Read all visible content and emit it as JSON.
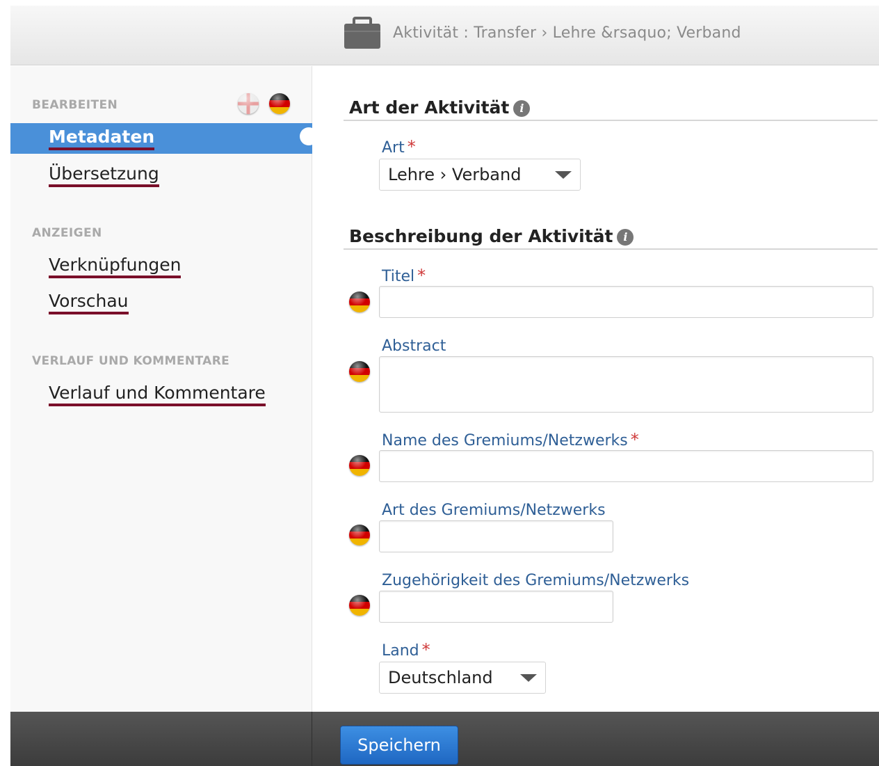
{
  "header": {
    "title": "Aktivität : Transfer › Lehre &rsaquo; Verband",
    "icon": "briefcase-icon"
  },
  "sidebar": {
    "edit_heading": "BEARBEITEN",
    "edit_items": [
      {
        "label": "Metadaten",
        "active": true
      },
      {
        "label": "Übersetzung",
        "active": false
      }
    ],
    "view_heading": "ANZEIGEN",
    "view_items": [
      {
        "label": "Verknüpfungen"
      },
      {
        "label": "Vorschau"
      }
    ],
    "history_heading": "VERLAUF UND KOMMENTARE",
    "history_items": [
      {
        "label": "Verlauf und Kommentare"
      }
    ],
    "language_flags": [
      "uk-flag-icon",
      "de-flag-icon"
    ]
  },
  "main": {
    "section_type": {
      "title": "Art der Aktivität",
      "field_art": {
        "label": "Art",
        "required": "*",
        "value": "Lehre › Verband"
      }
    },
    "section_description": {
      "title": "Beschreibung der Aktivität",
      "fields": [
        {
          "label": "Titel",
          "required": "*",
          "value": ""
        },
        {
          "label": "Abstract",
          "required": "",
          "value": ""
        },
        {
          "label": "Name des Gremiums/Netzwerks",
          "required": "*",
          "value": ""
        },
        {
          "label": "Art des Gremiums/Netzwerks",
          "required": "",
          "value": ""
        },
        {
          "label": "Zugehörigkeit des Gremiums/Netzwerks",
          "required": "",
          "value": ""
        },
        {
          "label": "Land",
          "required": "*",
          "value": "Deutschland"
        }
      ]
    }
  },
  "footer": {
    "save_label": "Speichern"
  },
  "colors": {
    "accent": "#4a90d9",
    "label_blue": "#2f5f96",
    "required_red": "#cf3a3a",
    "underline": "#7a0f2a",
    "button_blue": "#2a77d0"
  }
}
